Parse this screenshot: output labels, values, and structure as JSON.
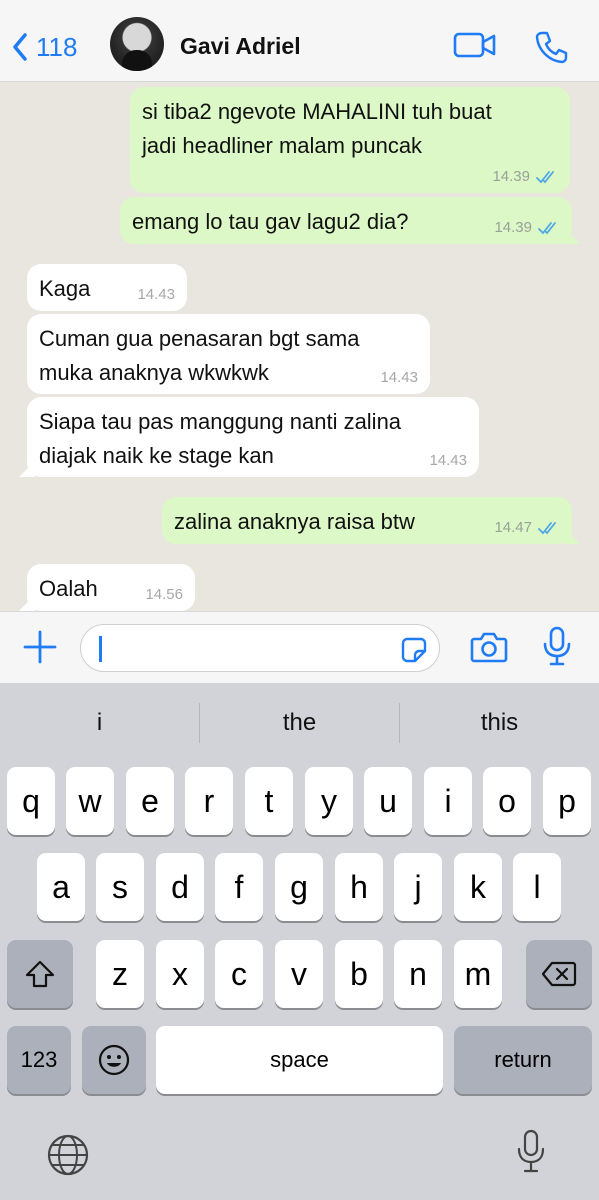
{
  "header": {
    "back_count": "118",
    "contact_name": "Gavi Adriel"
  },
  "messages": [
    {
      "direction": "out",
      "lines": [
        "si tiba2 ngevote MAHALINI tuh buat",
        "jadi headliner malam puncak"
      ],
      "time": "14.39",
      "read": true
    },
    {
      "direction": "out",
      "lines": [
        "emang lo tau gav lagu2 dia?"
      ],
      "time": "14.39",
      "read": true
    },
    {
      "direction": "in",
      "lines": [
        "Kaga"
      ],
      "time": "14.43"
    },
    {
      "direction": "in",
      "lines": [
        "Cuman gua penasaran bgt sama",
        "muka anaknya wkwkwk"
      ],
      "time": "14.43"
    },
    {
      "direction": "in",
      "lines": [
        "Siapa tau pas manggung nanti zalina",
        "diajak naik ke stage kan"
      ],
      "time": "14.43"
    },
    {
      "direction": "out",
      "lines": [
        "zalina anaknya raisa btw"
      ],
      "time": "14.47",
      "read": true
    },
    {
      "direction": "in",
      "lines": [
        "Oalah"
      ],
      "time": "14.56"
    }
  ],
  "input": {
    "value": ""
  },
  "keyboard": {
    "suggestions": [
      "i",
      "the",
      "this"
    ],
    "row1": [
      "q",
      "w",
      "e",
      "r",
      "t",
      "y",
      "u",
      "i",
      "o",
      "p"
    ],
    "row2": [
      "a",
      "s",
      "d",
      "f",
      "g",
      "h",
      "j",
      "k",
      "l"
    ],
    "row3": [
      "z",
      "x",
      "c",
      "v",
      "b",
      "n",
      "m"
    ],
    "numbers_label": "123",
    "space_label": "space",
    "return_label": "return"
  },
  "colors": {
    "accent": "#1f7cf6",
    "outgoing_bubble": "#dcf8c6",
    "incoming_bubble": "#ffffff",
    "chat_background": "#e9e6df",
    "read_ticks": "#4fa8e6"
  }
}
